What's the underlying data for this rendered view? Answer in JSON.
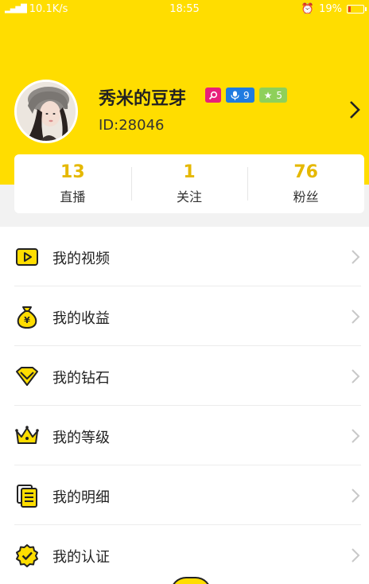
{
  "status_bar": {
    "network_speed": "10.1K/s",
    "time": "18:55",
    "battery": "19%",
    "battery_level": 0.19
  },
  "profile": {
    "name": "秀米的豆芽",
    "id": "ID:28046",
    "badges": [
      {
        "icon": "search-icon",
        "value": "",
        "color": "#e8207a"
      },
      {
        "icon": "mic-icon",
        "value": "9",
        "color": "#1f7be0"
      },
      {
        "icon": "star-icon",
        "value": "5",
        "color": "#8ed05a"
      }
    ]
  },
  "stats": [
    {
      "value": "13",
      "label": "直播"
    },
    {
      "value": "1",
      "label": "关注"
    },
    {
      "value": "76",
      "label": "粉丝"
    }
  ],
  "menu": [
    {
      "label": "我的视频",
      "icon": "video-icon"
    },
    {
      "label": "我的收益",
      "icon": "money-bag-icon"
    },
    {
      "label": "我的钻石",
      "icon": "diamond-icon"
    },
    {
      "label": "我的等级",
      "icon": "crown-icon"
    },
    {
      "label": "我的明细",
      "icon": "document-list-icon"
    },
    {
      "label": "我的认证",
      "icon": "verified-badge-icon"
    }
  ],
  "colors": {
    "accent": "#ffdd00",
    "stat_number": "#e5b800"
  }
}
